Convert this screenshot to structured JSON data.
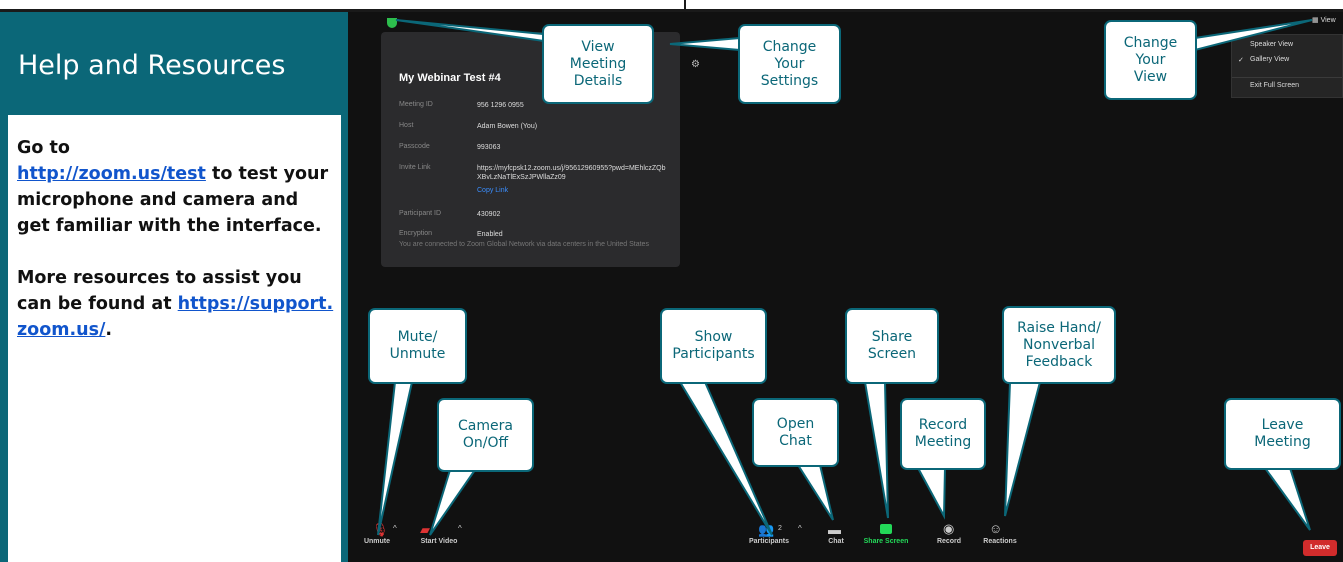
{
  "sidebar": {
    "title": "Help and Resources",
    "text1": "Go to",
    "link1": "http://zoom.us/test",
    "text2": " to test your microphone and camera and get familiar with the interface.",
    "text3": "More resources to assist you can be found at ",
    "link2": "https://support.zoom.us/",
    "text4": "."
  },
  "meeting_panel": {
    "title": "My Webinar Test #4",
    "meeting_id_label": "Meeting ID",
    "meeting_id": "956 1296 0955",
    "host_label": "Host",
    "host": "Adam Bowen (You)",
    "passcode_label": "Passcode",
    "passcode": "993063",
    "invite_label": "Invite Link",
    "invite_link": "https://myfcpsk12.zoom.us/j/95612960955?pwd=MEhlczZQbXBvLzNaTlExSzJPWllaZz09",
    "copy_link": "Copy Link",
    "participant_id_label": "Participant ID",
    "participant_id": "430902",
    "encryption_label": "Encryption",
    "encryption": "Enabled",
    "network_note": "You are connected to Zoom Global Network via data centers in the United States"
  },
  "view_menu": {
    "button": "View",
    "speaker": "Speaker View",
    "gallery": "Gallery View",
    "gallery_check": "✓",
    "exit": "Exit Full Screen"
  },
  "toolbar": {
    "unmute": "Unmute",
    "start_video": "Start Video",
    "participants": "Participants",
    "participant_count": "2",
    "chat": "Chat",
    "share_screen": "Share Screen",
    "record": "Record",
    "reactions": "Reactions",
    "leave": "Leave"
  },
  "callouts": {
    "view_details": "View\nMeeting\nDetails",
    "change_settings": "Change\nYour\nSettings",
    "change_view": "Change\nYour\nView",
    "mute": "Mute/\nUnmute",
    "camera": "Camera\nOn/Off",
    "participants": "Show\nParticipants",
    "chat": "Open\nChat",
    "share": "Share\nScreen",
    "record": "Record\nMeeting",
    "reactions": "Raise Hand/\nNonverbal\nFeedback",
    "leave": "Leave\nMeeting"
  },
  "colors": {
    "sidebar_bg": "#0b6778",
    "zoom_bg": "#111111",
    "share_green": "#23d959",
    "leave_red": "#d12c2c",
    "link_blue": "#1155cc"
  }
}
